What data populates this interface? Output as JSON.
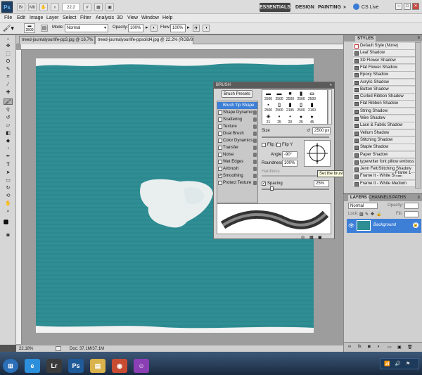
{
  "app": {
    "logo": "Ps",
    "zoom_field": "22.2",
    "workspaces": [
      "ESSENTIALS",
      "DESIGN",
      "PAINTING"
    ],
    "more": "»",
    "cs_live": "CS Live",
    "min": "–",
    "max": "□",
    "close": "✕"
  },
  "menu": [
    "File",
    "Edit",
    "Image",
    "Layer",
    "Select",
    "Filter",
    "Analysis",
    "3D",
    "View",
    "Window",
    "Help"
  ],
  "options": {
    "brush_size": "2500",
    "mode_label": "Mode:",
    "mode_value": "Normal",
    "opacity_label": "Opacity:",
    "opacity_value": "100%",
    "flow_label": "Flow:",
    "flow_value": "100%"
  },
  "tabs": [
    "treed-journalyourlife-pp3.jpg @ 16.7% (RGB/8) ×",
    "treed-journalyourlife-ppsolid4.jpg @ 22.2% (RGB/8) ×"
  ],
  "status": {
    "zoom": "22.18%",
    "doc": "Doc: 37.1M/37.1M"
  },
  "canvas_color": "#2e8e94",
  "brush_panel": {
    "title": "BRUSH",
    "presets_button": "Brush Presets",
    "options": [
      {
        "label": "Brush Tip Shape",
        "checked": false,
        "lock": false
      },
      {
        "label": "Shape Dynamics",
        "checked": false,
        "lock": true
      },
      {
        "label": "Scattering",
        "checked": false,
        "lock": true
      },
      {
        "label": "Texture",
        "checked": false,
        "lock": true
      },
      {
        "label": "Dual Brush",
        "checked": false,
        "lock": true
      },
      {
        "label": "Color Dynamics",
        "checked": false,
        "lock": true
      },
      {
        "label": "Transfer",
        "checked": false,
        "lock": true
      },
      {
        "label": "Noise",
        "checked": false,
        "lock": true
      },
      {
        "label": "Wet Edges",
        "checked": false,
        "lock": true
      },
      {
        "label": "Airbrush",
        "checked": false,
        "lock": true
      },
      {
        "label": "Smoothing",
        "checked": true,
        "lock": true
      },
      {
        "label": "Protect Texture",
        "checked": false,
        "lock": true
      }
    ],
    "tips": [
      {
        "glyph": "▬",
        "size": "2500"
      },
      {
        "glyph": "▬",
        "size": "2500"
      },
      {
        "glyph": "■",
        "size": "2500"
      },
      {
        "glyph": "▮",
        "size": "2500"
      },
      {
        "glyph": "▭",
        "size": "2500"
      },
      {
        "glyph": "",
        "size": ""
      },
      {
        "glyph": "▪",
        "size": "2500"
      },
      {
        "glyph": "▯",
        "size": "2500"
      },
      {
        "glyph": "▮",
        "size": "2195"
      },
      {
        "glyph": "▯",
        "size": "2500"
      },
      {
        "glyph": "▮",
        "size": "2160"
      },
      {
        "glyph": "",
        "size": ""
      },
      {
        "glyph": "✳",
        "size": "21"
      },
      {
        "glyph": "•",
        "size": "25"
      },
      {
        "glyph": "•",
        "size": "20"
      },
      {
        "glyph": "●",
        "size": "25"
      },
      {
        "glyph": "●",
        "size": "45"
      },
      {
        "glyph": "",
        "size": ""
      }
    ],
    "size_label": "Size",
    "size_value": "2500 px",
    "flip_x": "Flip X",
    "flip_y": "Flip Y",
    "angle_label": "Angle:",
    "angle_value": "-90°",
    "roundness_label": "Roundness:",
    "roundness_value": "100%",
    "hardness_label": "Hardness",
    "spacing_label": "Spacing",
    "spacing_value": "25%",
    "tooltip": "Set the brush angle and roundness"
  },
  "styles_panel": {
    "title": "STYLES",
    "items": [
      "Default Style (None)",
      "Leaf Shadow",
      "3D Flower Shadow",
      "Flat Flower Shadow",
      "Epoxy Shadow",
      "Acrylic Shadow",
      "Button Shadow",
      "Curled Ribbon Shadow",
      "Flat Ribbon Shadow",
      "String Shadow",
      "Wire Shadow",
      "Lace & Fabric Shadow",
      "Vellum Shadow",
      "Stitching Shadow",
      "Staple Shadow",
      "Paper Shadow",
      "typewriter font pillow emboss",
      "Jenn Felt/Stitching Shadow",
      "Frame It - White Small",
      "Frame It - White Medium"
    ],
    "obscured_item": "Frame 1"
  },
  "layers_panel": {
    "tabs": [
      "LAYERS",
      "CHANNELS",
      "PATHS"
    ],
    "blend": "Normal",
    "opacity_label": "Opacity:",
    "fill_label": "Fill:",
    "lock_label": "Lock:",
    "layer_name": "Background"
  },
  "taskbar": {
    "apps": [
      {
        "label": "",
        "color": "#2a6fb8",
        "glyph": "⊞"
      },
      {
        "label": "",
        "color": "#2c8fdb",
        "glyph": "e"
      },
      {
        "label": "Lr",
        "color": "#3b3b3b",
        "glyph": "Lr"
      },
      {
        "label": "Ps",
        "color": "#1f5a99",
        "glyph": "Ps"
      },
      {
        "label": "",
        "color": "#d9b24c",
        "glyph": "▤"
      },
      {
        "label": "",
        "color": "#c84c32",
        "glyph": "◉"
      },
      {
        "label": "",
        "color": "#8b3fb5",
        "glyph": "☺"
      }
    ]
  }
}
